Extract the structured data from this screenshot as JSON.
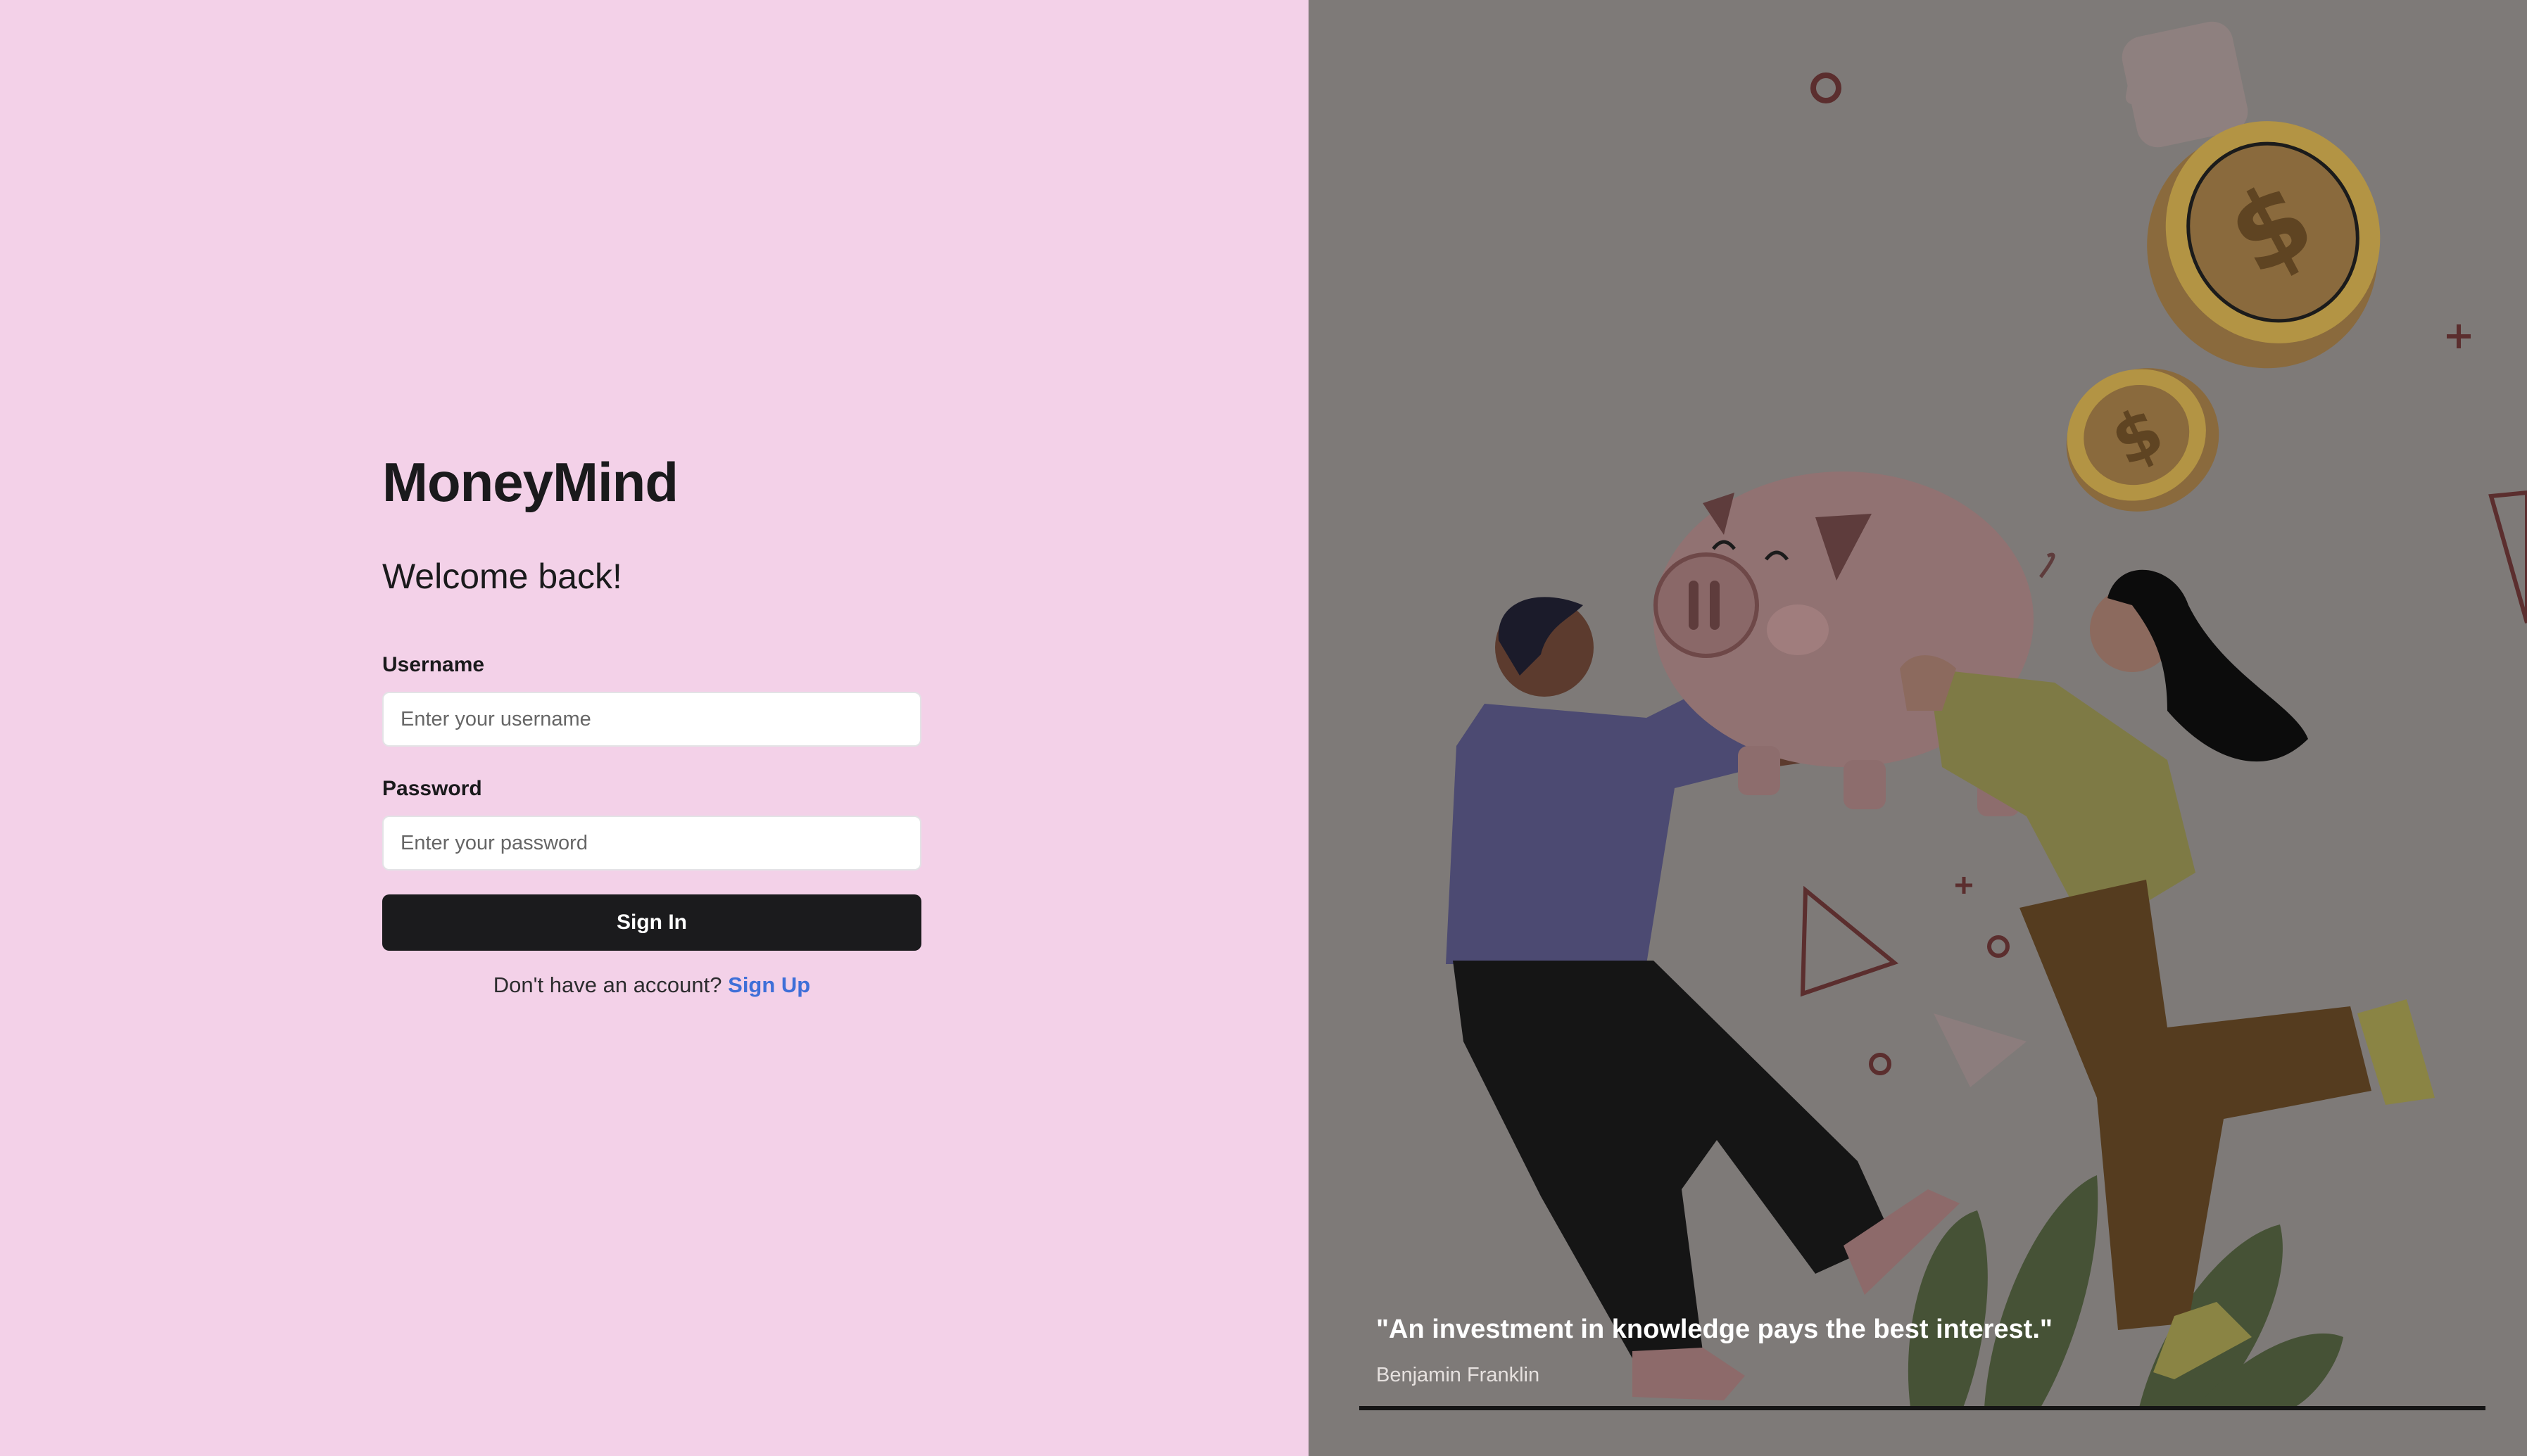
{
  "brand": {
    "name": "MoneyMind"
  },
  "login": {
    "heading": "Welcome back!",
    "username_label": "Username",
    "username_placeholder": "Enter your username",
    "username_value": "",
    "password_label": "Password",
    "password_placeholder": "Enter your password",
    "password_value": "",
    "submit_label": "Sign In",
    "signup_prompt": "Don't have an account?",
    "signup_link": "Sign Up"
  },
  "hero": {
    "quote": "\"An investment in knowledge pays the best interest.\"",
    "author": "Benjamin Franklin"
  },
  "colors": {
    "left_background": "#f3d1e8",
    "right_background": "#7e7a78",
    "primary_button": "#1b1b1d",
    "link": "#3e6fd8"
  },
  "icons": [
    "coin-icon",
    "piggy-bank-icon"
  ]
}
